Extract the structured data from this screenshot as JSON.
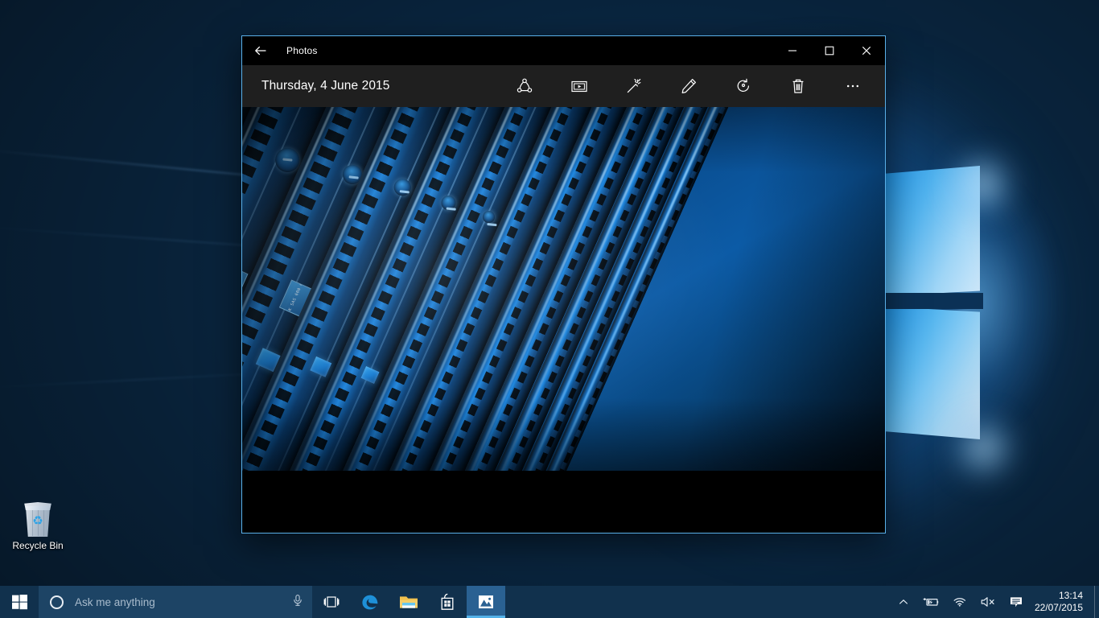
{
  "desktop": {
    "wallpaper_name": "windows-10-hero-wallpaper",
    "icons": [
      {
        "name": "recycle-bin",
        "label": "Recycle Bin",
        "icon": "recycle-bin-icon"
      }
    ]
  },
  "photos_window": {
    "titlebar": {
      "back_icon": "back-arrow-icon",
      "title": "Photos",
      "minimize_icon": "minimize-icon",
      "maximize_icon": "maximize-icon",
      "close_icon": "close-icon",
      "minimize_label": "—",
      "maximize_label": "□",
      "close_label": "✕"
    },
    "commandbar": {
      "photo_date": "Thursday, 4 June 2015",
      "buttons": [
        {
          "name": "share-button",
          "icon": "share-icon",
          "label": "Share"
        },
        {
          "name": "slideshow-button",
          "icon": "slideshow-icon",
          "label": "Slideshow"
        },
        {
          "name": "enhance-button",
          "icon": "magic-wand-icon",
          "label": "Enhance"
        },
        {
          "name": "edit-button",
          "icon": "pencil-icon",
          "label": "Edit"
        },
        {
          "name": "rotate-button",
          "icon": "rotate-icon",
          "label": "Rotate"
        },
        {
          "name": "delete-button",
          "icon": "trash-icon",
          "label": "Delete"
        },
        {
          "name": "more-button",
          "icon": "ellipsis-icon",
          "label": "See more"
        }
      ]
    },
    "viewer": {
      "image_description": "Close-up of blue-lit server hard drive bays arranged diagonally",
      "drive_label_lines": [
        "15K",
        "SAS",
        "600 GB",
        "653952"
      ]
    }
  },
  "taskbar": {
    "start_button": {
      "name": "start-button",
      "icon": "windows-logo-icon"
    },
    "search": {
      "placeholder": "Ask me anything",
      "cortana_icon": "cortana-circle-icon",
      "mic_icon": "microphone-icon"
    },
    "buttons": [
      {
        "name": "task-view-button",
        "icon": "task-view-icon",
        "label": "Task View",
        "active": false
      },
      {
        "name": "edge-button",
        "icon": "edge-icon",
        "label": "Microsoft Edge",
        "active": false
      },
      {
        "name": "file-explorer-button",
        "icon": "folder-icon",
        "label": "File Explorer",
        "active": false
      },
      {
        "name": "store-button",
        "icon": "store-bag-icon",
        "label": "Store",
        "active": false
      },
      {
        "name": "photos-taskbar-button",
        "icon": "photos-icon",
        "label": "Photos",
        "active": true
      }
    ],
    "tray": [
      {
        "name": "show-hidden-icons-button",
        "icon": "chevron-up-icon"
      },
      {
        "name": "battery-status-icon",
        "icon": "battery-charging-icon"
      },
      {
        "name": "network-status-icon",
        "icon": "wifi-icon"
      },
      {
        "name": "volume-status-icon",
        "icon": "speaker-muted-icon"
      },
      {
        "name": "action-center-button",
        "icon": "action-center-icon"
      }
    ],
    "clock": {
      "time": "13:14",
      "date": "22/07/2015"
    }
  },
  "colors": {
    "accent": "#53b1e8",
    "taskbar": "#11314d",
    "window_chrome": "#000000",
    "command_bar": "#1f1f1f"
  }
}
